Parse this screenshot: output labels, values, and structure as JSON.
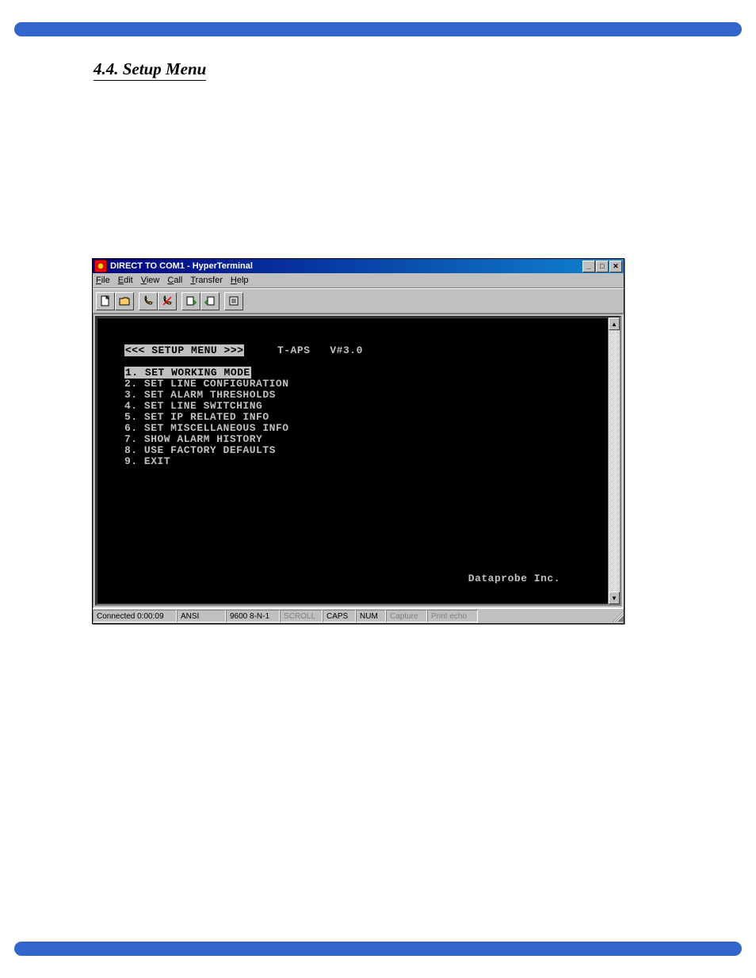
{
  "page": {
    "section_title": "4.4. Setup Menu"
  },
  "window": {
    "title": "DIRECT TO COM1 - HyperTerminal",
    "menubar": [
      "File",
      "Edit",
      "View",
      "Call",
      "Transfer",
      "Help"
    ],
    "toolbar_icons": [
      "new-doc-icon",
      "open-icon",
      "phone-connect-icon",
      "phone-disconnect-icon",
      "send-icon",
      "receive-icon",
      "properties-icon"
    ]
  },
  "terminal": {
    "header_inv": "<<< SETUP MENU >>>",
    "header_right": "T-APS   V#3.0",
    "selected_line_inv": "1. SET WORKING MODE",
    "menu_items": [
      "2. SET LINE CONFIGURATION",
      "3. SET ALARM THRESHOLDS",
      "4. SET LINE SWITCHING",
      "5. SET IP RELATED INFO",
      "6. SET MISCELLANEOUS INFO",
      "7. SHOW ALARM HISTORY",
      "8. USE FACTORY DEFAULTS",
      "9. EXIT"
    ],
    "footer_text": "Dataprobe Inc."
  },
  "status": {
    "connected": "Connected 0:00:09",
    "emulation": "ANSI",
    "line": "9600 8-N-1",
    "scroll": "SCROLL",
    "caps": "CAPS",
    "num": "NUM",
    "capture": "Capture",
    "printecho": "Print echo"
  }
}
